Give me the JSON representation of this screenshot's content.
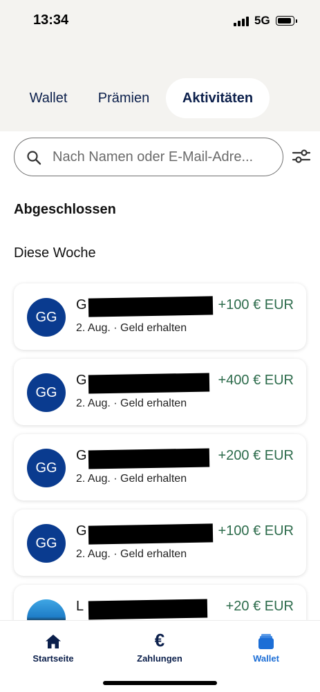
{
  "status_bar": {
    "time": "13:34",
    "network": "5G"
  },
  "tabs": [
    {
      "label": "Wallet",
      "active": false
    },
    {
      "label": "Prämien",
      "active": false
    },
    {
      "label": "Aktivitäten",
      "active": true
    }
  ],
  "search": {
    "placeholder": "Nach Namen oder E-Mail-Adre..."
  },
  "section_title": "Abgeschlossen",
  "week_title": "Diese Woche",
  "transactions": [
    {
      "initials": "GG",
      "name": "G",
      "date_status": "2. Aug. · Geld erhalten",
      "amount": "+100 € EUR"
    },
    {
      "initials": "GG",
      "name": "G",
      "date_status": "2. Aug. · Geld erhalten",
      "amount": "+400 € EUR"
    },
    {
      "initials": "GG",
      "name": "G",
      "date_status": "2. Aug. · Geld erhalten",
      "amount": "+200 € EUR"
    },
    {
      "initials": "GG",
      "name": "G",
      "date_status": "2. Aug. · Geld erhalten",
      "amount": "+100 € EUR"
    },
    {
      "initials": "",
      "name": "L",
      "date_status": "",
      "amount": "+20 € EUR"
    }
  ],
  "bottom_nav": [
    {
      "label": "Startseite",
      "icon": "home-icon"
    },
    {
      "label": "Zahlungen",
      "icon": "euro-icon"
    },
    {
      "label": "Wallet",
      "icon": "wallet-icon",
      "active": true
    }
  ],
  "colors": {
    "brand_navy": "#0b1f4b",
    "avatar_blue": "#0a3b8f",
    "amount_green": "#2c6b4b",
    "active_blue": "#1c6ed6"
  }
}
